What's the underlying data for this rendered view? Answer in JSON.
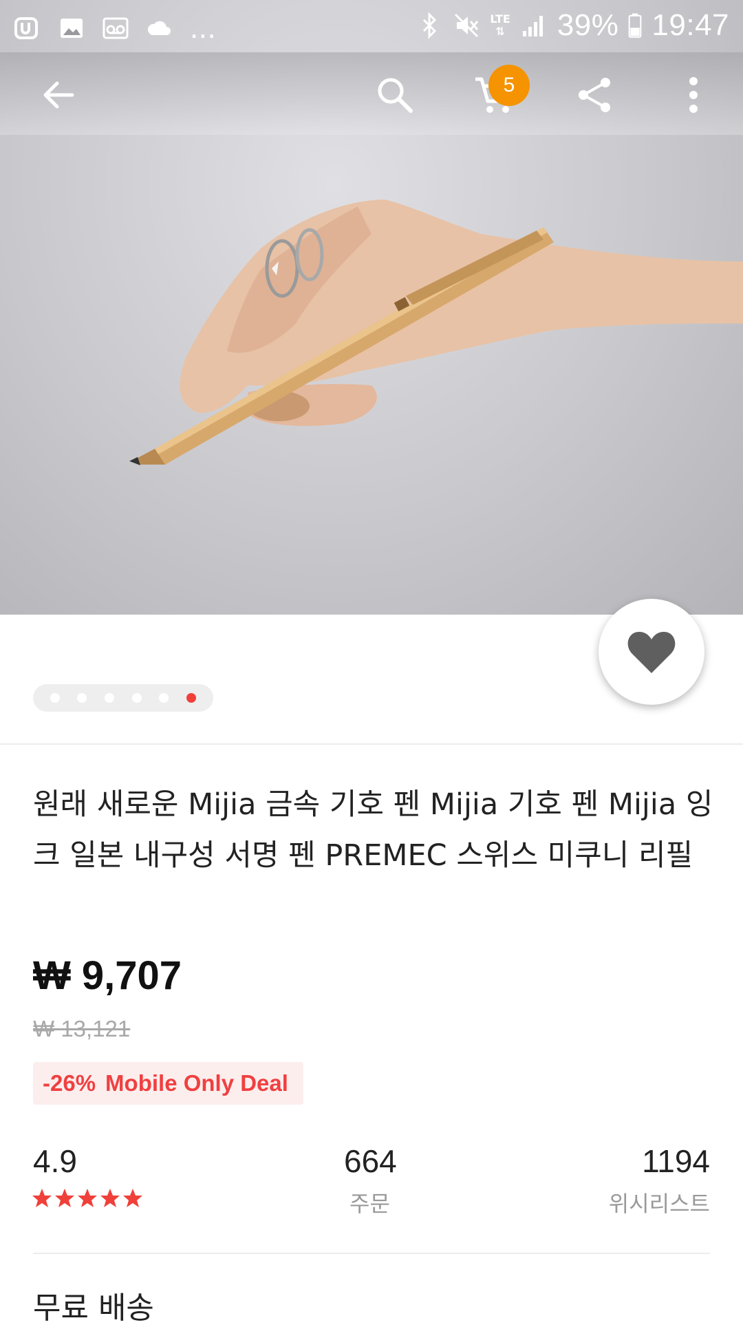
{
  "status_bar": {
    "battery": "39%",
    "time": "19:47",
    "network": "LTE",
    "left_icons": [
      "app-icon",
      "gallery-icon",
      "voicemail-icon",
      "cloud-icon"
    ],
    "more_indicator": "...",
    "right_icons": [
      "bluetooth-icon",
      "mute-icon",
      "lte-icon",
      "signal-icon",
      "battery-icon"
    ]
  },
  "toolbar": {
    "cart_count": "5",
    "icons": [
      "back-arrow-icon",
      "search-icon",
      "cart-icon",
      "share-icon",
      "more-vert-icon"
    ]
  },
  "gallery": {
    "image_count": 6,
    "active_index": 5,
    "wishlist_icon": "heart-icon"
  },
  "product": {
    "title": "원래 새로운 Mijia 금속 기호 펜 Mijia 기호 펜 Mijia 잉크 일본 내구성 서명 펜 PREMEC 스위스 미쿠니 리필",
    "price": "₩ 9,707",
    "original_price": "₩ 13,121",
    "discount": "-26%",
    "deal_label": "Mobile Only Deal"
  },
  "stats": {
    "rating": "4.9",
    "rating_stars": 5,
    "orders": "664",
    "orders_label": "주문",
    "wishlist_count": "1194",
    "wishlist_label": "위시리스트"
  },
  "shipping": {
    "label": "무료 배송"
  },
  "colors": {
    "accent_red": "#f0403a",
    "badge_orange": "#f59300",
    "deal_bg": "#fdeeee"
  }
}
